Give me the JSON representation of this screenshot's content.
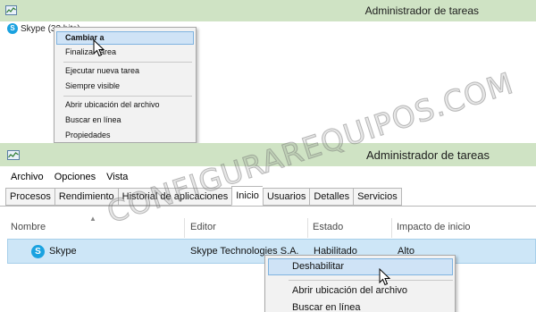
{
  "top_window": {
    "title": "Administrador de tareas",
    "process_label": "Skype (32 bits)",
    "context_menu": {
      "items": [
        "Cambiar a",
        "Finalizar tarea",
        "Ejecutar nueva tarea",
        "Siempre visible",
        "Abrir ubicación del archivo",
        "Buscar en línea",
        "Propiedades"
      ],
      "highlighted_index": 0
    }
  },
  "bottom_window": {
    "title": "Administrador de tareas",
    "menubar": [
      "Archivo",
      "Opciones",
      "Vista"
    ],
    "tabs": [
      "Procesos",
      "Rendimiento",
      "Historial de aplicaciones",
      "Inicio",
      "Usuarios",
      "Detalles",
      "Servicios"
    ],
    "active_tab_index": 3,
    "columns": [
      "Nombre",
      "Editor",
      "Estado",
      "Impacto de inicio"
    ],
    "row": {
      "name": "Skype",
      "publisher": "Skype Technologies S.A.",
      "status": "Habilitado",
      "impact": "Alto"
    },
    "context_menu": {
      "items": [
        "Deshabilitar",
        "Abrir ubicación del archivo",
        "Buscar en línea"
      ],
      "highlighted_index": 0
    }
  },
  "watermark": "CONFIGURAREQUIPOS.COM",
  "icons": {
    "app": "task-manager-icon",
    "skype": "skype-icon",
    "cursor": "mouse-cursor-icon",
    "sort": "sort-ascending-icon"
  },
  "colors": {
    "titlebar": "#cfe3c4",
    "selection": "#cde6f7",
    "menu_highlight": "#cfe3f6",
    "skype_brand": "#1aa2e0"
  }
}
